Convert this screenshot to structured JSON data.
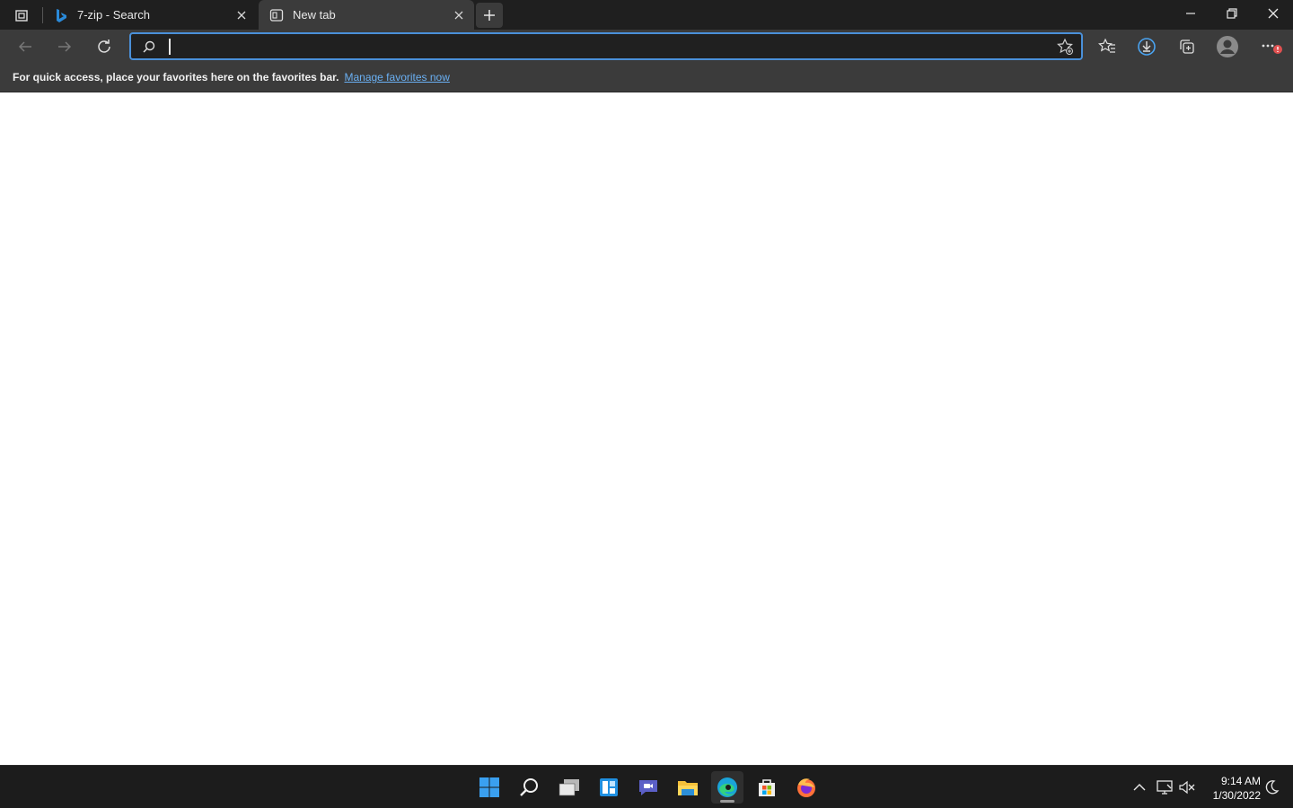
{
  "tabs": [
    {
      "title": "7-zip - Search",
      "icon": "bing-icon"
    },
    {
      "title": "New tab",
      "icon": "newtab-page-icon"
    }
  ],
  "address_bar": {
    "value": "",
    "placeholder": ""
  },
  "favorites_bar": {
    "message": "For quick access, place your favorites here on the favorites bar.",
    "link": "Manage favorites now"
  },
  "taskbar": {
    "apps": [
      "start-icon",
      "search-icon",
      "task-view-icon",
      "widgets-icon",
      "chat-icon",
      "file-explorer-icon",
      "edge-icon",
      "store-icon",
      "firefox-icon"
    ],
    "active_app": "edge-icon"
  },
  "clock": {
    "time": "9:14 AM",
    "date": "1/30/2022"
  },
  "colors": {
    "accent": "#4a90d9",
    "link": "#6ab0f3",
    "titlebar": "#1f1f1f",
    "toolbar": "#3b3b3b",
    "taskbar": "#1c1c1c"
  }
}
